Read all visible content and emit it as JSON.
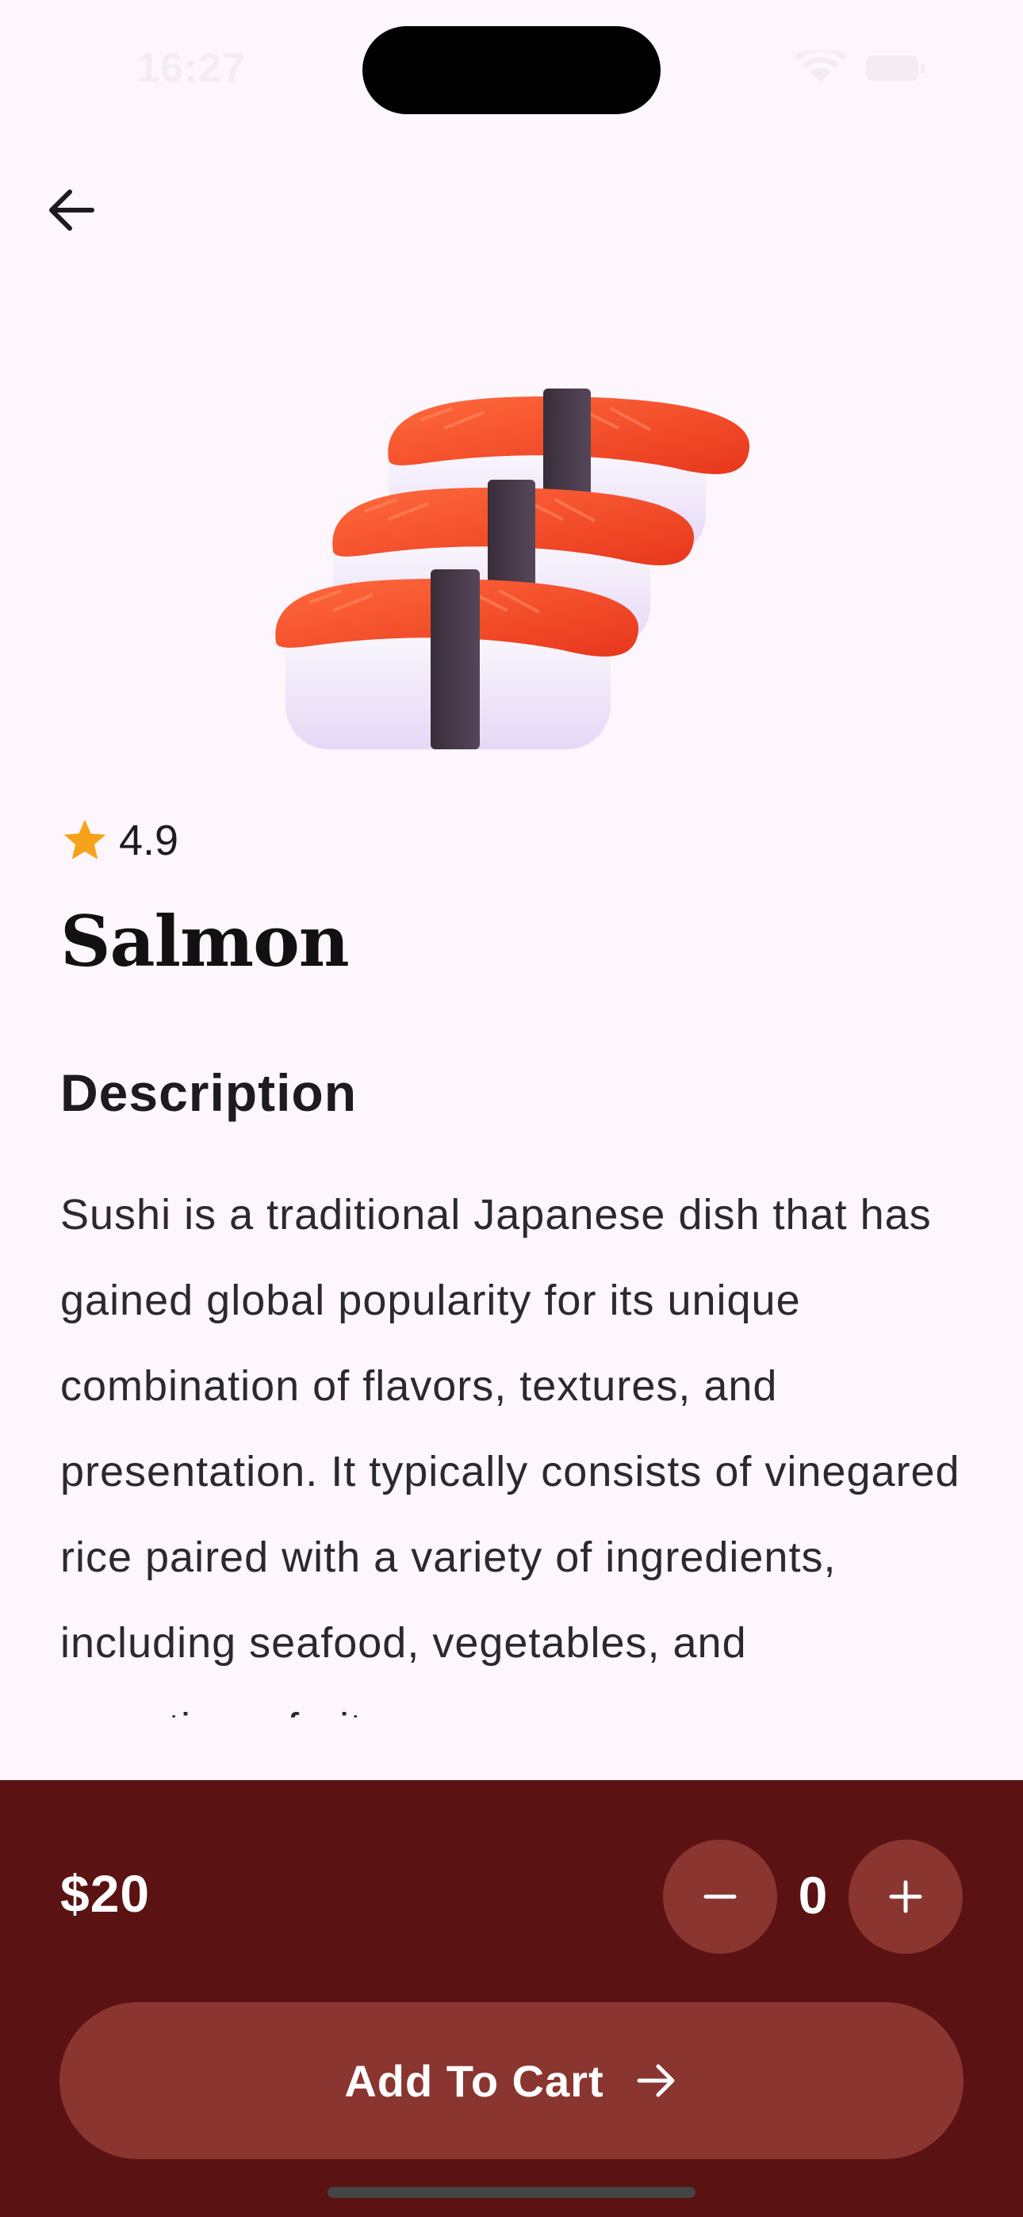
{
  "status_bar": {
    "time": "16:27",
    "icons": [
      "wifi-icon",
      "battery-icon"
    ]
  },
  "nav": {
    "back_icon": "arrow-left-icon"
  },
  "product": {
    "image_icon": "salmon-sushi-illustration",
    "rating": "4.9",
    "rating_icon": "star-icon",
    "name": "Salmon",
    "description_heading": "Description",
    "description": "Sushi is a traditional Japanese dish that has gained global popularity for its unique combination of flavors, textures, and presentation. It typically consists of vinegared rice paired with a variety of ingredients, including seafood, vegetables, and sometimes fruit."
  },
  "cart_bar": {
    "price": "$20",
    "quantity": "0",
    "minus_icon": "minus-icon",
    "plus_icon": "plus-icon",
    "add_to_cart_label": "Add To Cart",
    "add_to_cart_icon": "arrow-right-icon"
  },
  "colors": {
    "background": "#fdf6fc",
    "bottom_bar": "#5a1212",
    "button": "#8a3530",
    "star": "#f6a21b",
    "salmon": "#f5502c"
  }
}
